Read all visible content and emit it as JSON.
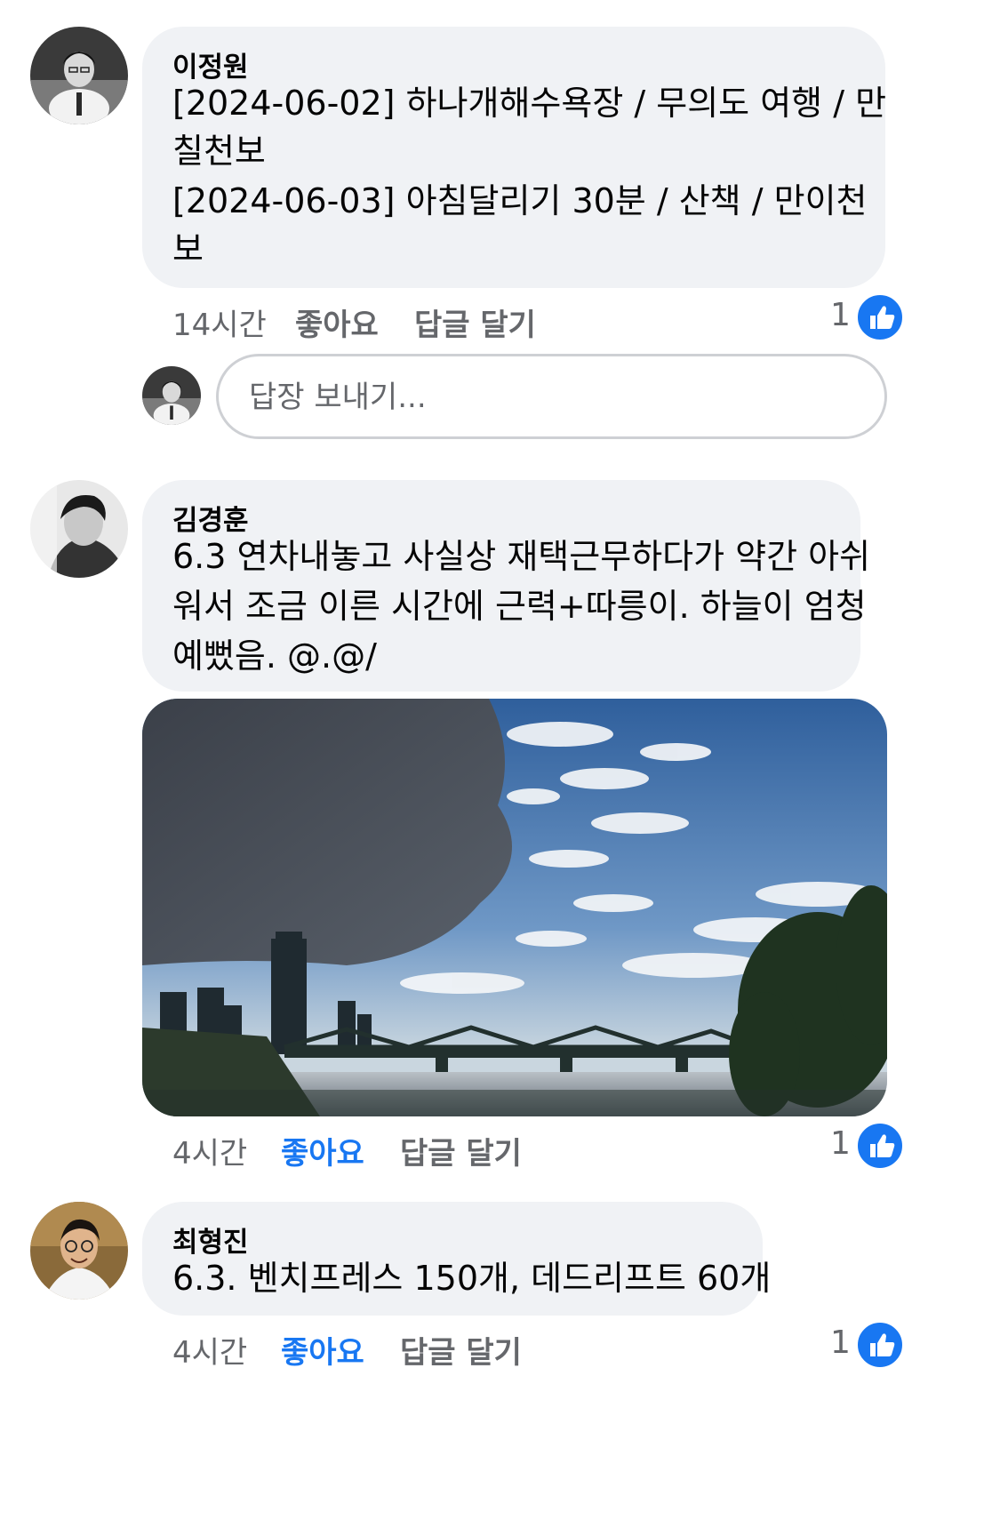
{
  "colors": {
    "bubble": "#f0f2f5",
    "meta_text": "#65676b",
    "accent": "#1877f2",
    "text": "#050505"
  },
  "comments": [
    {
      "author": "이정원",
      "lines": [
        "[2024-06-02] 하나개해수욕장 / 무의도 여행 / 만",
        "칠천보",
        "[2024-06-03] 아침달리기 30분 / 산책 / 만이천",
        "보"
      ],
      "time": "14시간",
      "like_label": "좋아요",
      "liked": false,
      "reply_label": "답글 달기",
      "reaction_count": "1",
      "reaction_icon": "thumbs-up-icon"
    },
    {
      "author": "김경훈",
      "lines": [
        "6.3 연차내놓고 사실상 재택근무하다가 약간 아쉬",
        "워서 조금 이른 시간에 근력+따릉이. 하늘이 엄청",
        "예뻤음. @.@/"
      ],
      "time": "4시간",
      "like_label": "좋아요",
      "liked": true,
      "reply_label": "답글 달기",
      "reaction_count": "1",
      "reaction_icon": "thumbs-up-icon"
    },
    {
      "author": "최형진",
      "lines": [
        "6.3. 벤치프레스 150개, 데드리프트 60개"
      ],
      "time": "4시간",
      "like_label": "좋아요",
      "liked": true,
      "reply_label": "답글 달기",
      "reaction_count": "1",
      "reaction_icon": "thumbs-up-icon"
    }
  ],
  "reply_input": {
    "placeholder": "답장 보내기..."
  }
}
